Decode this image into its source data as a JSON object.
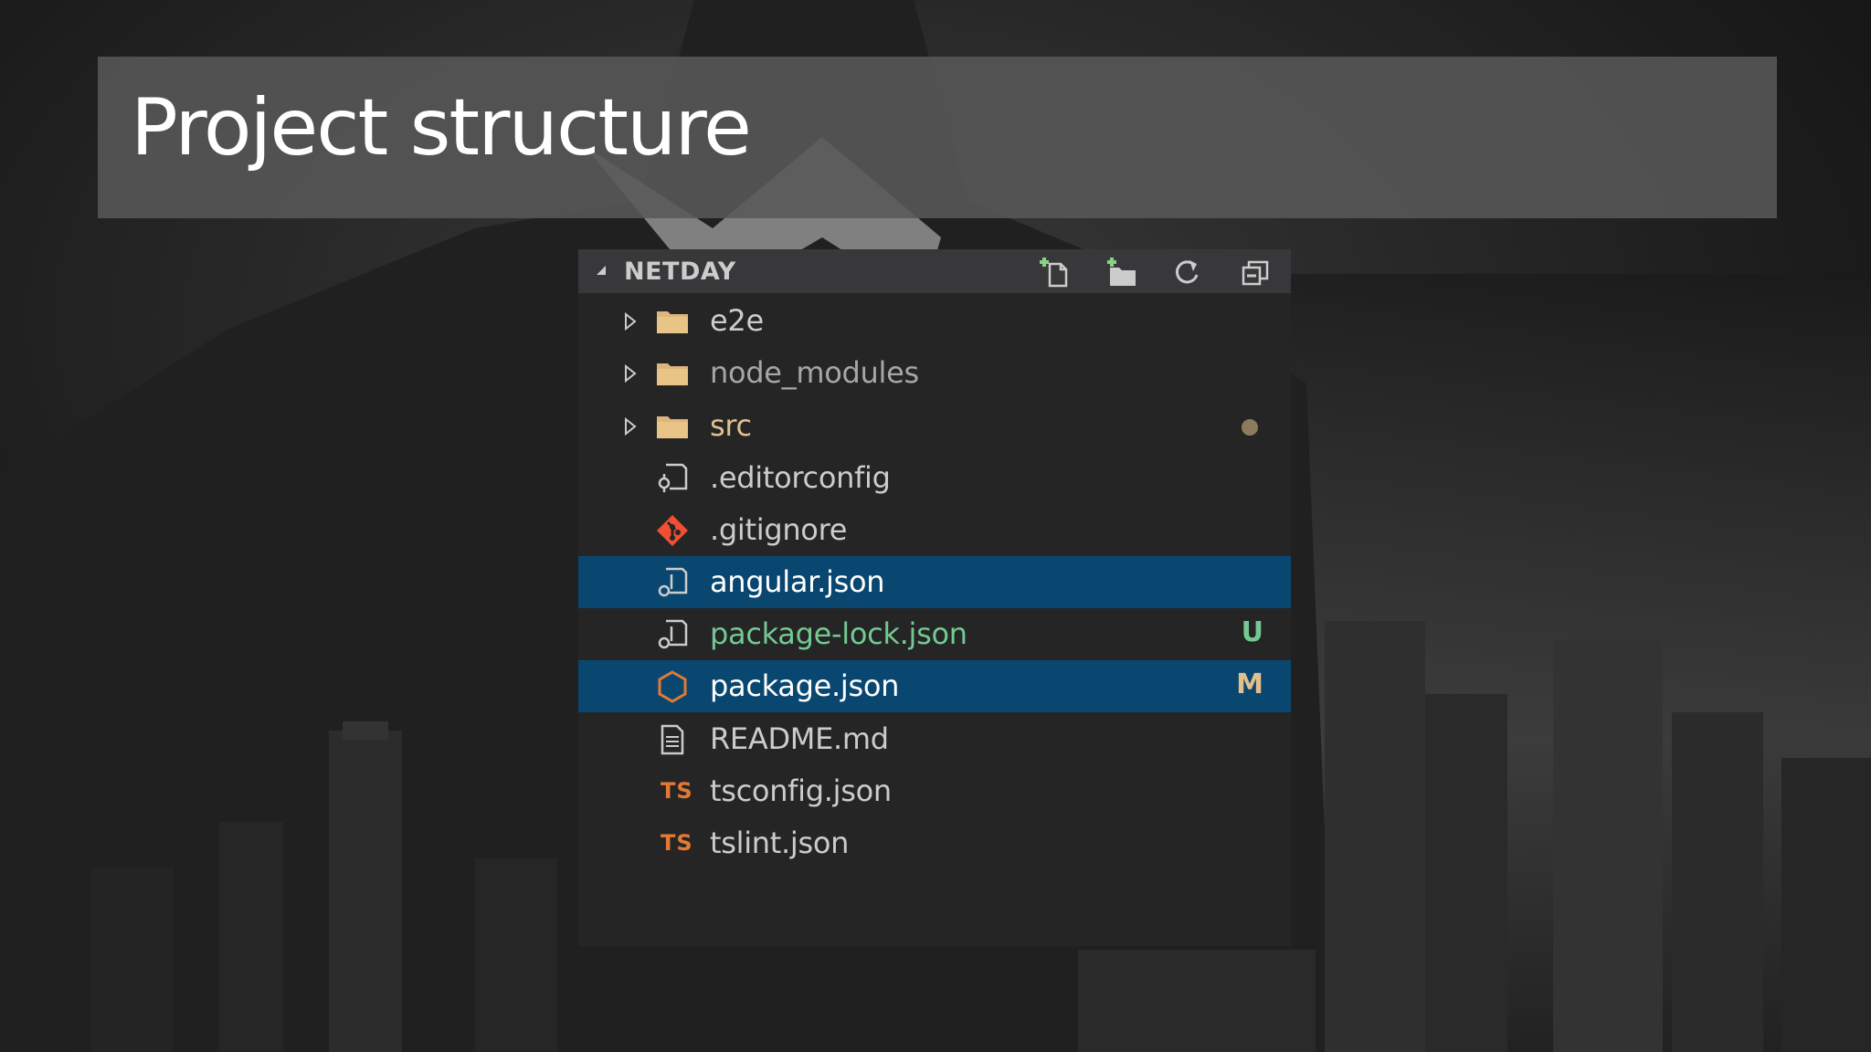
{
  "slide": {
    "title": "Project structure"
  },
  "explorer": {
    "title": "NETDAY",
    "toolbar": [
      {
        "icon": "new-file-icon"
      },
      {
        "icon": "new-folder-icon"
      },
      {
        "icon": "refresh-icon"
      },
      {
        "icon": "collapse-all-icon"
      }
    ],
    "items": [
      {
        "label": "e2e",
        "type": "folder",
        "icon": "folder-icon"
      },
      {
        "label": "node_modules",
        "type": "folder",
        "icon": "folder-icon"
      },
      {
        "label": "src",
        "type": "folder",
        "icon": "folder-icon",
        "status": "dot"
      },
      {
        "label": ".editorconfig",
        "type": "file",
        "icon": "editorconfig-icon"
      },
      {
        "label": ".gitignore",
        "type": "file",
        "icon": "git-icon"
      },
      {
        "label": "angular.json",
        "type": "file",
        "icon": "json-icon",
        "selected": true
      },
      {
        "label": "package-lock.json",
        "type": "file",
        "icon": "json-icon",
        "status": "U"
      },
      {
        "label": "package.json",
        "type": "file",
        "icon": "nodejs-icon",
        "selected": true,
        "status": "M"
      },
      {
        "label": "README.md",
        "type": "file",
        "icon": "markdown-file-icon"
      },
      {
        "label": "tsconfig.json",
        "type": "file",
        "icon": "typescript-icon",
        "icon_text": "TS"
      },
      {
        "label": "tslint.json",
        "type": "file",
        "icon": "typescript-icon",
        "icon_text": "TS"
      }
    ]
  },
  "colors": {
    "selection": "#094771",
    "untracked": "#73c991",
    "modified_folder": "#e2c08d",
    "modified_badge": "#e2c08d",
    "untracked_badge": "#73c991",
    "folder": "#dcb67a",
    "git": "#f14e32",
    "typescript": "#e37933"
  }
}
